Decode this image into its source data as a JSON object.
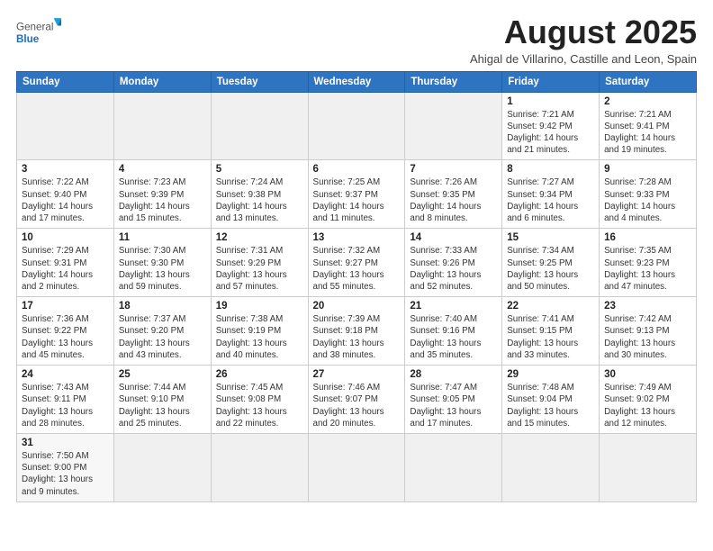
{
  "logo": {
    "general": "General",
    "blue": "Blue"
  },
  "header": {
    "month": "August 2025",
    "location": "Ahigal de Villarino, Castille and Leon, Spain"
  },
  "weekdays": [
    "Sunday",
    "Monday",
    "Tuesday",
    "Wednesday",
    "Thursday",
    "Friday",
    "Saturday"
  ],
  "weeks": [
    [
      {
        "day": "",
        "info": ""
      },
      {
        "day": "",
        "info": ""
      },
      {
        "day": "",
        "info": ""
      },
      {
        "day": "",
        "info": ""
      },
      {
        "day": "",
        "info": ""
      },
      {
        "day": "1",
        "info": "Sunrise: 7:21 AM\nSunset: 9:42 PM\nDaylight: 14 hours and 21 minutes."
      },
      {
        "day": "2",
        "info": "Sunrise: 7:21 AM\nSunset: 9:41 PM\nDaylight: 14 hours and 19 minutes."
      }
    ],
    [
      {
        "day": "3",
        "info": "Sunrise: 7:22 AM\nSunset: 9:40 PM\nDaylight: 14 hours and 17 minutes."
      },
      {
        "day": "4",
        "info": "Sunrise: 7:23 AM\nSunset: 9:39 PM\nDaylight: 14 hours and 15 minutes."
      },
      {
        "day": "5",
        "info": "Sunrise: 7:24 AM\nSunset: 9:38 PM\nDaylight: 14 hours and 13 minutes."
      },
      {
        "day": "6",
        "info": "Sunrise: 7:25 AM\nSunset: 9:37 PM\nDaylight: 14 hours and 11 minutes."
      },
      {
        "day": "7",
        "info": "Sunrise: 7:26 AM\nSunset: 9:35 PM\nDaylight: 14 hours and 8 minutes."
      },
      {
        "day": "8",
        "info": "Sunrise: 7:27 AM\nSunset: 9:34 PM\nDaylight: 14 hours and 6 minutes."
      },
      {
        "day": "9",
        "info": "Sunrise: 7:28 AM\nSunset: 9:33 PM\nDaylight: 14 hours and 4 minutes."
      }
    ],
    [
      {
        "day": "10",
        "info": "Sunrise: 7:29 AM\nSunset: 9:31 PM\nDaylight: 14 hours and 2 minutes."
      },
      {
        "day": "11",
        "info": "Sunrise: 7:30 AM\nSunset: 9:30 PM\nDaylight: 13 hours and 59 minutes."
      },
      {
        "day": "12",
        "info": "Sunrise: 7:31 AM\nSunset: 9:29 PM\nDaylight: 13 hours and 57 minutes."
      },
      {
        "day": "13",
        "info": "Sunrise: 7:32 AM\nSunset: 9:27 PM\nDaylight: 13 hours and 55 minutes."
      },
      {
        "day": "14",
        "info": "Sunrise: 7:33 AM\nSunset: 9:26 PM\nDaylight: 13 hours and 52 minutes."
      },
      {
        "day": "15",
        "info": "Sunrise: 7:34 AM\nSunset: 9:25 PM\nDaylight: 13 hours and 50 minutes."
      },
      {
        "day": "16",
        "info": "Sunrise: 7:35 AM\nSunset: 9:23 PM\nDaylight: 13 hours and 47 minutes."
      }
    ],
    [
      {
        "day": "17",
        "info": "Sunrise: 7:36 AM\nSunset: 9:22 PM\nDaylight: 13 hours and 45 minutes."
      },
      {
        "day": "18",
        "info": "Sunrise: 7:37 AM\nSunset: 9:20 PM\nDaylight: 13 hours and 43 minutes."
      },
      {
        "day": "19",
        "info": "Sunrise: 7:38 AM\nSunset: 9:19 PM\nDaylight: 13 hours and 40 minutes."
      },
      {
        "day": "20",
        "info": "Sunrise: 7:39 AM\nSunset: 9:18 PM\nDaylight: 13 hours and 38 minutes."
      },
      {
        "day": "21",
        "info": "Sunrise: 7:40 AM\nSunset: 9:16 PM\nDaylight: 13 hours and 35 minutes."
      },
      {
        "day": "22",
        "info": "Sunrise: 7:41 AM\nSunset: 9:15 PM\nDaylight: 13 hours and 33 minutes."
      },
      {
        "day": "23",
        "info": "Sunrise: 7:42 AM\nSunset: 9:13 PM\nDaylight: 13 hours and 30 minutes."
      }
    ],
    [
      {
        "day": "24",
        "info": "Sunrise: 7:43 AM\nSunset: 9:11 PM\nDaylight: 13 hours and 28 minutes."
      },
      {
        "day": "25",
        "info": "Sunrise: 7:44 AM\nSunset: 9:10 PM\nDaylight: 13 hours and 25 minutes."
      },
      {
        "day": "26",
        "info": "Sunrise: 7:45 AM\nSunset: 9:08 PM\nDaylight: 13 hours and 22 minutes."
      },
      {
        "day": "27",
        "info": "Sunrise: 7:46 AM\nSunset: 9:07 PM\nDaylight: 13 hours and 20 minutes."
      },
      {
        "day": "28",
        "info": "Sunrise: 7:47 AM\nSunset: 9:05 PM\nDaylight: 13 hours and 17 minutes."
      },
      {
        "day": "29",
        "info": "Sunrise: 7:48 AM\nSunset: 9:04 PM\nDaylight: 13 hours and 15 minutes."
      },
      {
        "day": "30",
        "info": "Sunrise: 7:49 AM\nSunset: 9:02 PM\nDaylight: 13 hours and 12 minutes."
      }
    ],
    [
      {
        "day": "31",
        "info": "Sunrise: 7:50 AM\nSunset: 9:00 PM\nDaylight: 13 hours and 9 minutes."
      },
      {
        "day": "",
        "info": ""
      },
      {
        "day": "",
        "info": ""
      },
      {
        "day": "",
        "info": ""
      },
      {
        "day": "",
        "info": ""
      },
      {
        "day": "",
        "info": ""
      },
      {
        "day": "",
        "info": ""
      }
    ]
  ]
}
